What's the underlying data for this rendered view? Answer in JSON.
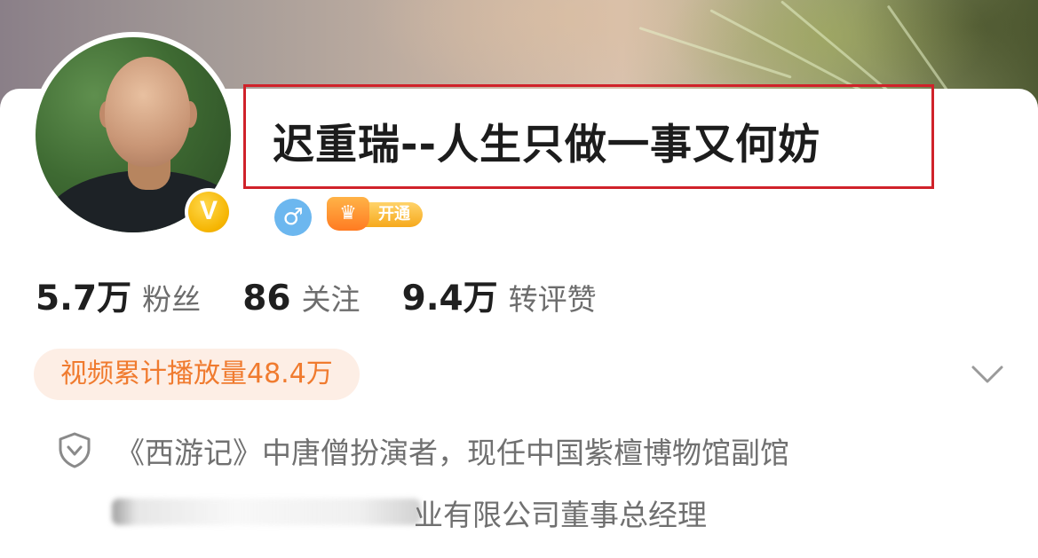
{
  "profile": {
    "name": "迟重瑞--人生只做一事又何妨",
    "verified_badge": "V",
    "gender_icon": "male-icon",
    "vip_label": "开通",
    "stats": [
      {
        "value": "5.7万",
        "label": "粉丝"
      },
      {
        "value": "86",
        "label": "关注"
      },
      {
        "value": "9.4万",
        "label": "转评赞"
      }
    ],
    "views_badge": "视频累计播放量48.4万",
    "bio_line1": "《西游记》中唐僧扮演者，现任中国紫檀博物馆副馆",
    "bio_line2_visible": "业有限公司董事总经理"
  },
  "colors": {
    "highlight_border": "#d0222a",
    "views_text": "#f07b2f",
    "views_bg": "#fdeee5",
    "verified": "#f5b400",
    "gender": "#6cb7ef"
  }
}
